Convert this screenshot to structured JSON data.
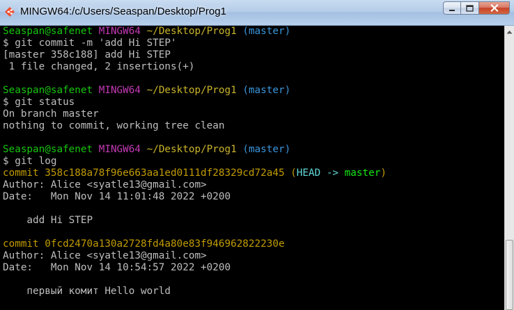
{
  "window": {
    "title": "MINGW64:/c/Users/Seaspan/Desktop/Prog1",
    "icon": "git-bash-icon",
    "buttons": [
      "minimize-icon",
      "maximize-icon",
      "close-icon"
    ]
  },
  "colors": {
    "prompt_user": "#16c60c",
    "prompt_env": "#c239b3",
    "prompt_path": "#c9b32b",
    "prompt_branch": "#3a96dd",
    "commit_hash": "#c19c00",
    "head": "#61d6d6",
    "branch_ref": "#13e813",
    "text": "#bfbfbf"
  },
  "terminal": {
    "lines": [
      {
        "segments": [
          {
            "text": "Seaspan@safenet",
            "color": "green"
          },
          {
            "text": " ",
            "color": "text"
          },
          {
            "text": "MINGW64",
            "color": "magenta"
          },
          {
            "text": " ",
            "color": "text"
          },
          {
            "text": "~/Desktop/Prog1",
            "color": "yellow"
          },
          {
            "text": " ",
            "color": "text"
          },
          {
            "text": "(master)",
            "color": "cyan"
          }
        ]
      },
      {
        "segments": [
          {
            "text": "$ git commit -m 'add Hi STEP'",
            "color": "text"
          }
        ]
      },
      {
        "segments": [
          {
            "text": "[master 358c188] add Hi STEP",
            "color": "text"
          }
        ]
      },
      {
        "segments": [
          {
            "text": " 1 file changed, 2 insertions(+)",
            "color": "text"
          }
        ]
      },
      {
        "segments": [
          {
            "text": "",
            "color": "text"
          }
        ]
      },
      {
        "segments": [
          {
            "text": "Seaspan@safenet",
            "color": "green"
          },
          {
            "text": " ",
            "color": "text"
          },
          {
            "text": "MINGW64",
            "color": "magenta"
          },
          {
            "text": " ",
            "color": "text"
          },
          {
            "text": "~/Desktop/Prog1",
            "color": "yellow"
          },
          {
            "text": " ",
            "color": "text"
          },
          {
            "text": "(master)",
            "color": "cyan"
          }
        ]
      },
      {
        "segments": [
          {
            "text": "$ git status",
            "color": "text"
          }
        ]
      },
      {
        "segments": [
          {
            "text": "On branch master",
            "color": "text"
          }
        ]
      },
      {
        "segments": [
          {
            "text": "nothing to commit, working tree clean",
            "color": "text"
          }
        ]
      },
      {
        "segments": [
          {
            "text": "",
            "color": "text"
          }
        ]
      },
      {
        "segments": [
          {
            "text": "Seaspan@safenet",
            "color": "green"
          },
          {
            "text": " ",
            "color": "text"
          },
          {
            "text": "MINGW64",
            "color": "magenta"
          },
          {
            "text": " ",
            "color": "text"
          },
          {
            "text": "~/Desktop/Prog1",
            "color": "yellow"
          },
          {
            "text": " ",
            "color": "text"
          },
          {
            "text": "(master)",
            "color": "cyan"
          }
        ]
      },
      {
        "segments": [
          {
            "text": "$ git log",
            "color": "text"
          }
        ]
      },
      {
        "segments": [
          {
            "text": "commit 358c188a78f96e663aa1ed0111df28329cd72a45",
            "color": "gold"
          },
          {
            "text": " (",
            "color": "gold"
          },
          {
            "text": "HEAD -> ",
            "color": "head"
          },
          {
            "text": "master",
            "color": "branch"
          },
          {
            "text": ")",
            "color": "gold"
          }
        ]
      },
      {
        "segments": [
          {
            "text": "Author: Alice <syatle13@gmail.com>",
            "color": "text"
          }
        ]
      },
      {
        "segments": [
          {
            "text": "Date:   Mon Nov 14 11:01:48 2022 +0200",
            "color": "text"
          }
        ]
      },
      {
        "segments": [
          {
            "text": "",
            "color": "text"
          }
        ]
      },
      {
        "segments": [
          {
            "text": "    add Hi STEP",
            "color": "text"
          }
        ]
      },
      {
        "segments": [
          {
            "text": "",
            "color": "text"
          }
        ]
      },
      {
        "segments": [
          {
            "text": "commit 0fcd2470a130a2728fd4a80e83f946962822230e",
            "color": "gold"
          }
        ]
      },
      {
        "segments": [
          {
            "text": "Author: Alice <syatle13@gmail.com>",
            "color": "text"
          }
        ]
      },
      {
        "segments": [
          {
            "text": "Date:   Mon Nov 14 10:54:57 2022 +0200",
            "color": "text"
          }
        ]
      },
      {
        "segments": [
          {
            "text": "",
            "color": "text"
          }
        ]
      },
      {
        "segments": [
          {
            "text": "    первый комит Hello world",
            "color": "text"
          }
        ]
      }
    ]
  },
  "scrollbar": {
    "icon": "scroll-up-arrow-icon",
    "position": 1.0
  }
}
